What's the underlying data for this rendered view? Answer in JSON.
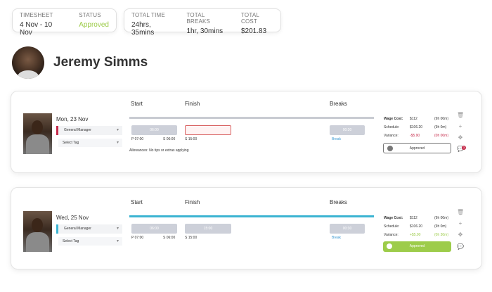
{
  "summary": {
    "timesheet_label": "TIMESHEET",
    "timesheet_value": "4 Nov - 10 Nov",
    "status_label": "STATUS",
    "status_value": "Approved",
    "total_time_label": "TOTAL TIME",
    "total_time_value": "24hrs, 35mins",
    "total_breaks_label": "TOTAL BREAKS",
    "total_breaks_value": "1hr, 30mins",
    "total_cost_label": "TOTAL COST",
    "total_cost_value": "$201.83"
  },
  "user": {
    "name": "Jeremy Simms"
  },
  "columns": {
    "start": "Start",
    "finish": "Finish",
    "breaks": "Breaks"
  },
  "shifts": [
    {
      "date": "Mon, 23 Nov",
      "role": "General Manager",
      "tag": "Select Tag",
      "start_value": "06:00",
      "finish_value": "",
      "break_value": "00:30",
      "planned_start": "P 07:00",
      "scheduled_start": "S 06:00",
      "scheduled_finish": "S 15:00",
      "break_label": "Break",
      "allowances": "Allowances: No tips or extras applying",
      "wage_cost_label": "Wage Cost:",
      "wage_cost_value": "$112",
      "wage_cost_time": "(9h 00m)",
      "schedule_label": "Schedule:",
      "schedule_value": "$106.20",
      "schedule_time": "(9h 0m)",
      "variance_label": "Variance:",
      "variance_value": "-$5.90",
      "variance_time": "(0h 00m)",
      "approve_label": "Approved",
      "comment_count": "3"
    },
    {
      "date": "Wed, 25 Nov",
      "role": "General Manager",
      "tag": "Select Tag",
      "start_value": "06:00",
      "finish_value": "15:00",
      "break_value": "00:30",
      "planned_start": "P 07:00",
      "scheduled_start": "S 06:00",
      "scheduled_finish": "S 15:00",
      "break_label": "Break",
      "wage_cost_label": "Wage Cost:",
      "wage_cost_value": "$112",
      "wage_cost_time": "(9h 00m)",
      "schedule_label": "Schedule:",
      "schedule_value": "$106.20",
      "schedule_time": "(9h 0m)",
      "variance_label": "Variance:",
      "variance_value": "+$5.90",
      "variance_time": "(0h 30m)",
      "approve_label": "Approved"
    }
  ],
  "icons": {
    "delete": "trash-icon",
    "add": "plus-icon",
    "move": "move-icon",
    "comment": "comment-icon"
  },
  "colors": {
    "approved_green": "#9dcc4a",
    "accent_red": "#c62a4a",
    "accent_blue": "#3cb4d2"
  }
}
